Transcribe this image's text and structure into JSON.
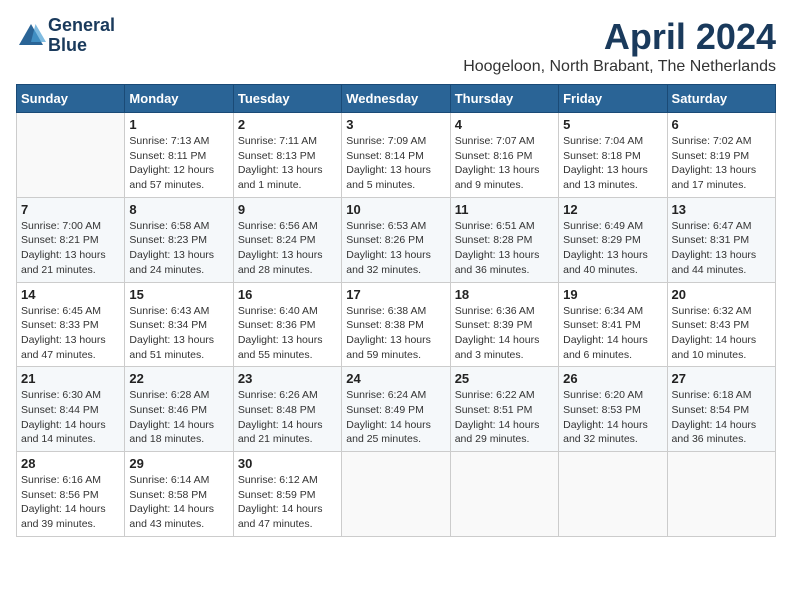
{
  "header": {
    "logo_line1": "General",
    "logo_line2": "Blue",
    "month_title": "April 2024",
    "location": "Hoogeloon, North Brabant, The Netherlands"
  },
  "weekdays": [
    "Sunday",
    "Monday",
    "Tuesday",
    "Wednesday",
    "Thursday",
    "Friday",
    "Saturday"
  ],
  "weeks": [
    [
      {
        "day": "",
        "sunrise": "",
        "sunset": "",
        "daylight": ""
      },
      {
        "day": "1",
        "sunrise": "Sunrise: 7:13 AM",
        "sunset": "Sunset: 8:11 PM",
        "daylight": "Daylight: 12 hours and 57 minutes."
      },
      {
        "day": "2",
        "sunrise": "Sunrise: 7:11 AM",
        "sunset": "Sunset: 8:13 PM",
        "daylight": "Daylight: 13 hours and 1 minute."
      },
      {
        "day": "3",
        "sunrise": "Sunrise: 7:09 AM",
        "sunset": "Sunset: 8:14 PM",
        "daylight": "Daylight: 13 hours and 5 minutes."
      },
      {
        "day": "4",
        "sunrise": "Sunrise: 7:07 AM",
        "sunset": "Sunset: 8:16 PM",
        "daylight": "Daylight: 13 hours and 9 minutes."
      },
      {
        "day": "5",
        "sunrise": "Sunrise: 7:04 AM",
        "sunset": "Sunset: 8:18 PM",
        "daylight": "Daylight: 13 hours and 13 minutes."
      },
      {
        "day": "6",
        "sunrise": "Sunrise: 7:02 AM",
        "sunset": "Sunset: 8:19 PM",
        "daylight": "Daylight: 13 hours and 17 minutes."
      }
    ],
    [
      {
        "day": "7",
        "sunrise": "Sunrise: 7:00 AM",
        "sunset": "Sunset: 8:21 PM",
        "daylight": "Daylight: 13 hours and 21 minutes."
      },
      {
        "day": "8",
        "sunrise": "Sunrise: 6:58 AM",
        "sunset": "Sunset: 8:23 PM",
        "daylight": "Daylight: 13 hours and 24 minutes."
      },
      {
        "day": "9",
        "sunrise": "Sunrise: 6:56 AM",
        "sunset": "Sunset: 8:24 PM",
        "daylight": "Daylight: 13 hours and 28 minutes."
      },
      {
        "day": "10",
        "sunrise": "Sunrise: 6:53 AM",
        "sunset": "Sunset: 8:26 PM",
        "daylight": "Daylight: 13 hours and 32 minutes."
      },
      {
        "day": "11",
        "sunrise": "Sunrise: 6:51 AM",
        "sunset": "Sunset: 8:28 PM",
        "daylight": "Daylight: 13 hours and 36 minutes."
      },
      {
        "day": "12",
        "sunrise": "Sunrise: 6:49 AM",
        "sunset": "Sunset: 8:29 PM",
        "daylight": "Daylight: 13 hours and 40 minutes."
      },
      {
        "day": "13",
        "sunrise": "Sunrise: 6:47 AM",
        "sunset": "Sunset: 8:31 PM",
        "daylight": "Daylight: 13 hours and 44 minutes."
      }
    ],
    [
      {
        "day": "14",
        "sunrise": "Sunrise: 6:45 AM",
        "sunset": "Sunset: 8:33 PM",
        "daylight": "Daylight: 13 hours and 47 minutes."
      },
      {
        "day": "15",
        "sunrise": "Sunrise: 6:43 AM",
        "sunset": "Sunset: 8:34 PM",
        "daylight": "Daylight: 13 hours and 51 minutes."
      },
      {
        "day": "16",
        "sunrise": "Sunrise: 6:40 AM",
        "sunset": "Sunset: 8:36 PM",
        "daylight": "Daylight: 13 hours and 55 minutes."
      },
      {
        "day": "17",
        "sunrise": "Sunrise: 6:38 AM",
        "sunset": "Sunset: 8:38 PM",
        "daylight": "Daylight: 13 hours and 59 minutes."
      },
      {
        "day": "18",
        "sunrise": "Sunrise: 6:36 AM",
        "sunset": "Sunset: 8:39 PM",
        "daylight": "Daylight: 14 hours and 3 minutes."
      },
      {
        "day": "19",
        "sunrise": "Sunrise: 6:34 AM",
        "sunset": "Sunset: 8:41 PM",
        "daylight": "Daylight: 14 hours and 6 minutes."
      },
      {
        "day": "20",
        "sunrise": "Sunrise: 6:32 AM",
        "sunset": "Sunset: 8:43 PM",
        "daylight": "Daylight: 14 hours and 10 minutes."
      }
    ],
    [
      {
        "day": "21",
        "sunrise": "Sunrise: 6:30 AM",
        "sunset": "Sunset: 8:44 PM",
        "daylight": "Daylight: 14 hours and 14 minutes."
      },
      {
        "day": "22",
        "sunrise": "Sunrise: 6:28 AM",
        "sunset": "Sunset: 8:46 PM",
        "daylight": "Daylight: 14 hours and 18 minutes."
      },
      {
        "day": "23",
        "sunrise": "Sunrise: 6:26 AM",
        "sunset": "Sunset: 8:48 PM",
        "daylight": "Daylight: 14 hours and 21 minutes."
      },
      {
        "day": "24",
        "sunrise": "Sunrise: 6:24 AM",
        "sunset": "Sunset: 8:49 PM",
        "daylight": "Daylight: 14 hours and 25 minutes."
      },
      {
        "day": "25",
        "sunrise": "Sunrise: 6:22 AM",
        "sunset": "Sunset: 8:51 PM",
        "daylight": "Daylight: 14 hours and 29 minutes."
      },
      {
        "day": "26",
        "sunrise": "Sunrise: 6:20 AM",
        "sunset": "Sunset: 8:53 PM",
        "daylight": "Daylight: 14 hours and 32 minutes."
      },
      {
        "day": "27",
        "sunrise": "Sunrise: 6:18 AM",
        "sunset": "Sunset: 8:54 PM",
        "daylight": "Daylight: 14 hours and 36 minutes."
      }
    ],
    [
      {
        "day": "28",
        "sunrise": "Sunrise: 6:16 AM",
        "sunset": "Sunset: 8:56 PM",
        "daylight": "Daylight: 14 hours and 39 minutes."
      },
      {
        "day": "29",
        "sunrise": "Sunrise: 6:14 AM",
        "sunset": "Sunset: 8:58 PM",
        "daylight": "Daylight: 14 hours and 43 minutes."
      },
      {
        "day": "30",
        "sunrise": "Sunrise: 6:12 AM",
        "sunset": "Sunset: 8:59 PM",
        "daylight": "Daylight: 14 hours and 47 minutes."
      },
      {
        "day": "",
        "sunrise": "",
        "sunset": "",
        "daylight": ""
      },
      {
        "day": "",
        "sunrise": "",
        "sunset": "",
        "daylight": ""
      },
      {
        "day": "",
        "sunrise": "",
        "sunset": "",
        "daylight": ""
      },
      {
        "day": "",
        "sunrise": "",
        "sunset": "",
        "daylight": ""
      }
    ]
  ]
}
